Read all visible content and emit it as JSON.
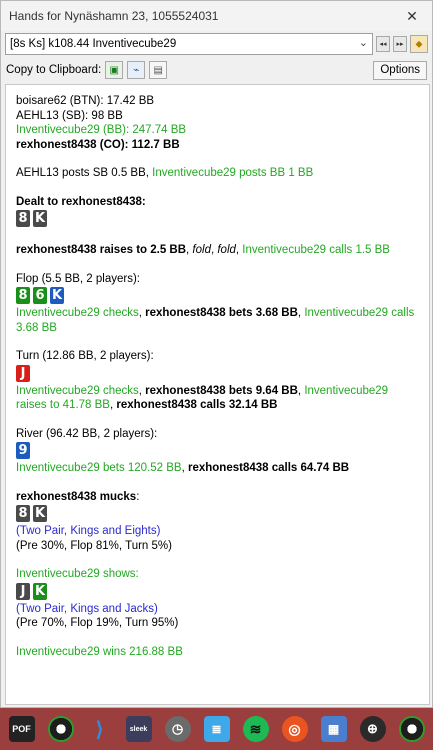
{
  "window": {
    "title": "Hands for Nynäshamn 23, 1055524031",
    "close_glyph": "✕"
  },
  "hand_selector": {
    "value": "[8s Ks] k108.44 Inventivecube29",
    "chevron": "⌄",
    "prev_glyph": "◂◂",
    "next_glyph": "▸▸",
    "tag_glyph": "⬥"
  },
  "toolbar": {
    "copy_label": "Copy to Clipboard:",
    "options_label": "Options"
  },
  "history": {
    "seats": {
      "btn": "boisare62 (BTN): 17.42 BB",
      "sb": "AEHL13 (SB): 98 BB",
      "bb": "Inventivecube29 (BB): 247.74 BB",
      "co": "rexhonest8438 (CO): 112.7 BB"
    },
    "blinds": {
      "sb": "AEHL13 posts SB 0.5 BB, ",
      "bb": "Inventivecube29 posts BB 1 BB"
    },
    "dealt": {
      "label": "Dealt to rexhonest8438:",
      "cards": [
        "8",
        "K"
      ]
    },
    "preflop": {
      "raise": "rexhonest8438 raises to 2.5 BB",
      "sep1": ", ",
      "fold1": "fold",
      "sep2": ", ",
      "fold2": "fold",
      "sep3": ", ",
      "call": "Inventivecube29 calls 1.5 BB"
    },
    "flop": {
      "header": "Flop (5.5 BB, 2 players):",
      "cards": [
        "8",
        "6",
        "K"
      ],
      "check": "Inventivecube29 checks",
      "sep1": ", ",
      "bet": "rexhonest8438 bets 3.68 BB",
      "sep2": ", ",
      "call": "Inventivecube29 calls 3.68 BB"
    },
    "turn": {
      "header": "Turn (12.86 BB, 2 players):",
      "card": "J",
      "check": "Inventivecube29 checks",
      "sep1": ", ",
      "bet": "rexhonest8438 bets 9.64 BB",
      "sep2": ", ",
      "raise": "Inventivecube29 raises to 41.78 BB",
      "sep3": ", ",
      "call": "rexhonest8438 calls 32.14 BB"
    },
    "river": {
      "header": "River (96.42 BB, 2 players):",
      "card": "9",
      "bet": "Inventivecube29 bets 120.52 BB",
      "sep1": ", ",
      "call": "rexhonest8438 calls 64.74 BB"
    },
    "showdown1": {
      "player": "rexhonest8438",
      "action": " mucks",
      "colon": ":",
      "cards": [
        "8",
        "K"
      ],
      "hand": "(Two Pair, Kings and Eights)",
      "equity": "(Pre 30%, Flop 81%, Turn 5%)"
    },
    "showdown2": {
      "line": "Inventivecube29 shows:",
      "cards": [
        "J",
        "K"
      ],
      "hand": "(Two Pair, Kings and Jacks)",
      "equity": "(Pre 70%, Flop 19%, Turn 95%)"
    },
    "result": "Inventivecube29 wins 216.88 BB"
  },
  "colors": {
    "hero": "#000000",
    "villain": "#22a822",
    "hand_desc": "#2a2ad0",
    "spade": "#4a4a4a",
    "club": "#1a8f1a",
    "diamond": "#1e5bbf",
    "heart": "#d8201a",
    "taskbar": "#9b3e3e"
  },
  "taskbar": {
    "items": [
      {
        "icon": "pokertracker-icon",
        "label": "POF"
      },
      {
        "icon": "poker-chip-icon",
        "label": ""
      },
      {
        "icon": "vscode-icon",
        "label": "⟩"
      },
      {
        "icon": "sleek-icon",
        "label": "sleek"
      },
      {
        "icon": "clock-icon",
        "label": "◷"
      },
      {
        "icon": "notepad-icon",
        "label": "≣"
      },
      {
        "icon": "spotify-icon",
        "label": "≋"
      },
      {
        "icon": "ubuntu-icon",
        "label": "◎"
      },
      {
        "icon": "calculator-icon",
        "label": "▦"
      },
      {
        "icon": "pt-icon",
        "label": "⊕"
      },
      {
        "icon": "poker-chip-icon",
        "label": ""
      }
    ]
  }
}
